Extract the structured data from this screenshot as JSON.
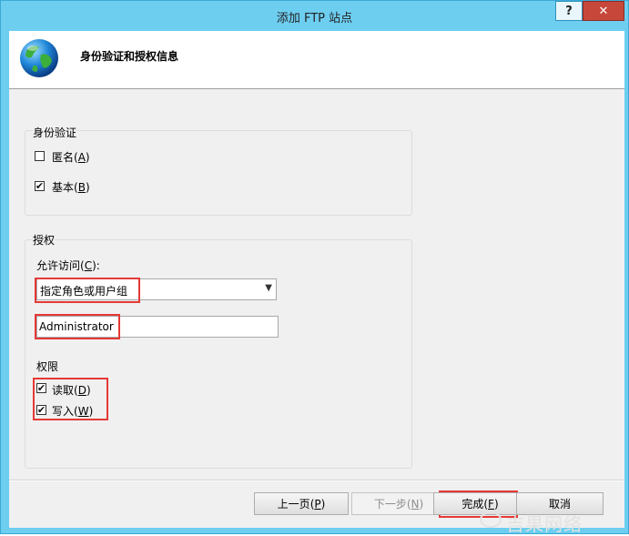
{
  "window": {
    "title": "添加 FTP 站点",
    "help_label": "?",
    "close_label": "✕"
  },
  "header": {
    "title": "身份验证和授权信息",
    "icon": "globe-icon"
  },
  "authentication": {
    "group_title": "身份验证",
    "anonymous": {
      "label": "匿名",
      "mnemonic": "A",
      "checked": false
    },
    "basic": {
      "label": "基本",
      "mnemonic": "B",
      "checked": true
    }
  },
  "authorization": {
    "group_title": "授权",
    "allow_access_label": "允许访问",
    "allow_access_mnemonic": "C",
    "allow_access_selected": "指定角色或用户组",
    "user_value": "Administrator",
    "permissions_label": "权限",
    "read": {
      "label": "读取",
      "mnemonic": "D",
      "checked": true
    },
    "write": {
      "label": "写入",
      "mnemonic": "W",
      "checked": true
    }
  },
  "buttons": {
    "previous": {
      "label": "上一页",
      "mnemonic": "P"
    },
    "next": {
      "label": "下一步",
      "mnemonic": "N",
      "disabled": true
    },
    "finish": {
      "label": "完成",
      "mnemonic": "F"
    },
    "cancel": {
      "label": "取消"
    }
  },
  "watermark": {
    "text": "吉果网络"
  },
  "colors": {
    "titlebar": "#6dcef0",
    "close_button": "#c7483b",
    "highlight": "#e53935",
    "dialog_background": "#f0f0f0"
  }
}
